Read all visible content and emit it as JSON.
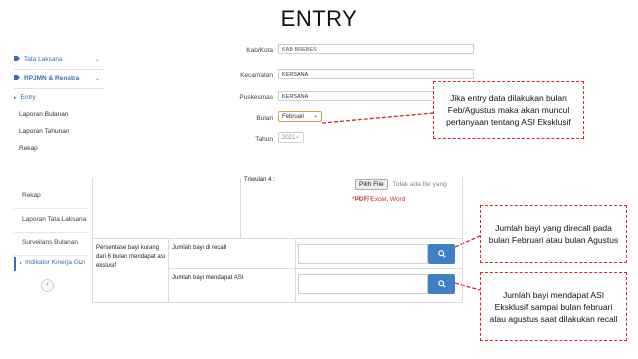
{
  "slide_title": "ENTRY",
  "top_sidebar": {
    "items": [
      {
        "label": "Tata Laksana",
        "chevron": "⌄"
      },
      {
        "label": "RPJMN & Renstra",
        "chevron": "⌄"
      },
      {
        "label": "Entry",
        "marker": "▸"
      },
      {
        "label": "Laporan Bulanan"
      },
      {
        "label": "Laporan Tahunan"
      },
      {
        "label": "Rekap"
      }
    ]
  },
  "form": {
    "kabkota_label": "Kab/Kota",
    "kabkota_value": "KAB BREBES",
    "kecamatan_label": "Kecamatan",
    "kecamatan_value": "KERSANA",
    "puskesmas_label": "Puskesmas",
    "puskesmas_value": "KERSANA",
    "bulan_label": "Bulan",
    "bulan_value": "Februari",
    "tahun_label": "Tahun",
    "tahun_value": "2021",
    "dropdown_arrow": "⌄"
  },
  "callouts": {
    "asi_question": "Jika entry data dilakukan bulan Feb/Agustus maka akan muncul pertanyaan tentang ASI Eksklusif",
    "recall": "Jumlah bayi yang direcall pada bulan Februari atau bulan Agustus",
    "asi_exclusive": "Jumlah bayi mendapat ASI Eksklusif sampai bulan februari atau agustus saat dilakukan recall"
  },
  "bottom_sidebar": {
    "items": [
      {
        "label": "Rekap"
      },
      {
        "label": "Laporan Tata Laksana"
      },
      {
        "label": "Surveilans Bulanan"
      },
      {
        "label": "Indikator Kinerja Gizi",
        "chevron": "⌄"
      }
    ],
    "collapse_button": "‹"
  },
  "upload": {
    "row_label": "Triwulan 4 :",
    "choose_button": "Pilih File",
    "no_file_text": "Tidak ada file yang dipilih",
    "hint": "*PDF, Excel, Word"
  },
  "table": {
    "indicator": "Persentase bayi kurang dari 6 bulan mendapat asi ekslusif",
    "rows": [
      {
        "label": "Jumlah bayi di recall",
        "value": ""
      },
      {
        "label": "Jumlah bayi mendapat ASI",
        "value": ""
      }
    ],
    "search_icon_glyph": "🔍"
  },
  "colors": {
    "accent_blue": "#3f7fc6",
    "callout_border": "#d8262b",
    "upload_hint": "#d8262b"
  }
}
